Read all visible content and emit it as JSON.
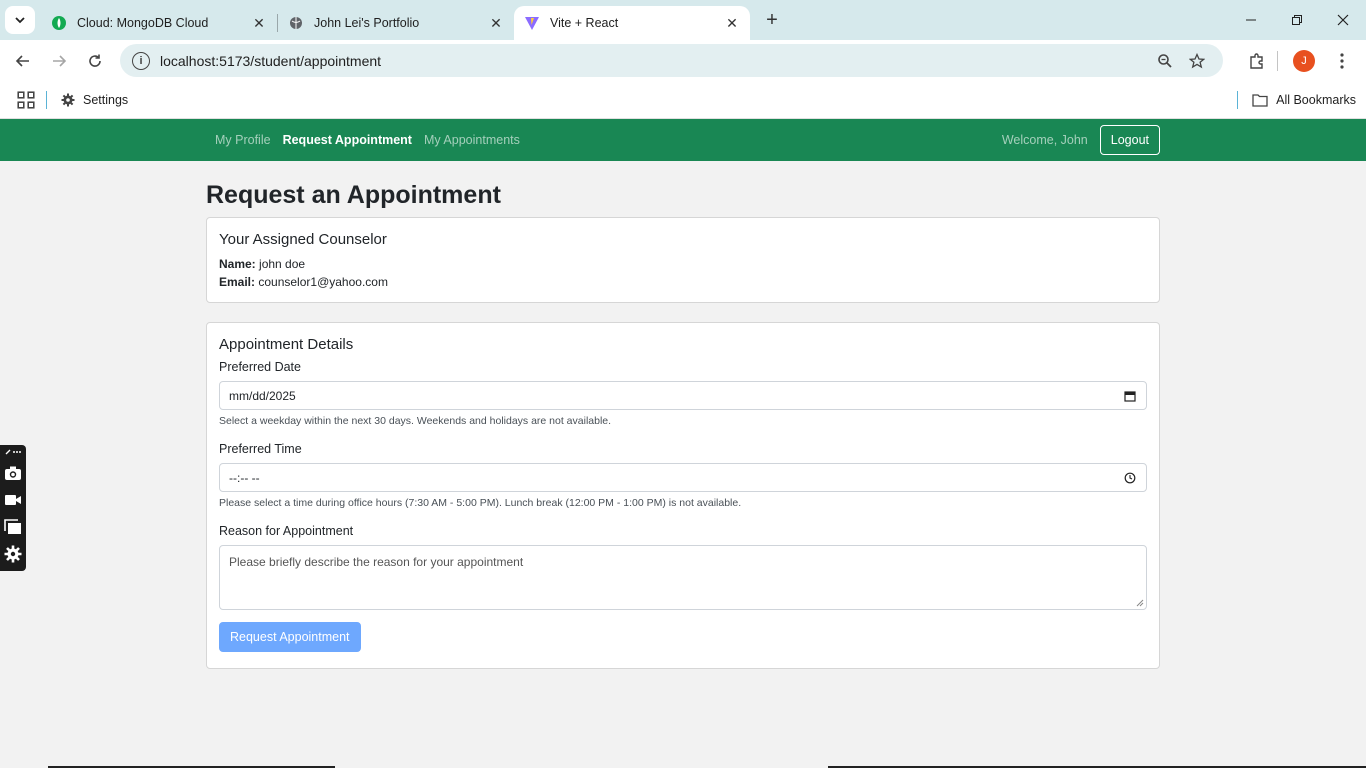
{
  "browser": {
    "tabs": [
      {
        "title": "Cloud: MongoDB Cloud",
        "icon": "mongodb-leaf-icon",
        "active": false
      },
      {
        "title": "John Lei's Portfolio",
        "icon": "globe-icon",
        "active": false
      },
      {
        "title": "Vite + React",
        "icon": "vite-icon",
        "active": true
      }
    ],
    "url_host": "localhost",
    "url_path": ":5173/student/appointment",
    "profile_initial": "J",
    "bookmarks": {
      "settings": "Settings",
      "all_bookmarks": "All Bookmarks"
    }
  },
  "nav": {
    "links": [
      "My Profile",
      "Request Appointment",
      "My Appointments"
    ],
    "active": "Request Appointment",
    "welcome": "Welcome, John",
    "logout": "Logout",
    "brand_color": "#198754"
  },
  "page": {
    "title": "Request an Appointment",
    "counselor": {
      "heading": "Your Assigned Counselor",
      "name_label": "Name:",
      "name": "john doe",
      "email_label": "Email:",
      "email": "counselor1@yahoo.com"
    },
    "details": {
      "heading": "Appointment Details",
      "date_label": "Preferred Date",
      "date_value": "mm/dd/2025",
      "date_help": "Select a weekday within the next 30 days. Weekends and holidays are not available.",
      "time_label": "Preferred Time",
      "time_value": "--:-- --",
      "time_help": "Please select a time during office hours (7:30 AM - 5:00 PM). Lunch break (12:00 PM - 1:00 PM) is not available.",
      "reason_label": "Reason for Appointment",
      "reason_placeholder": "Please briefly describe the reason for your appointment",
      "submit": "Request Appointment",
      "submit_color": "#6ea8fe"
    }
  }
}
